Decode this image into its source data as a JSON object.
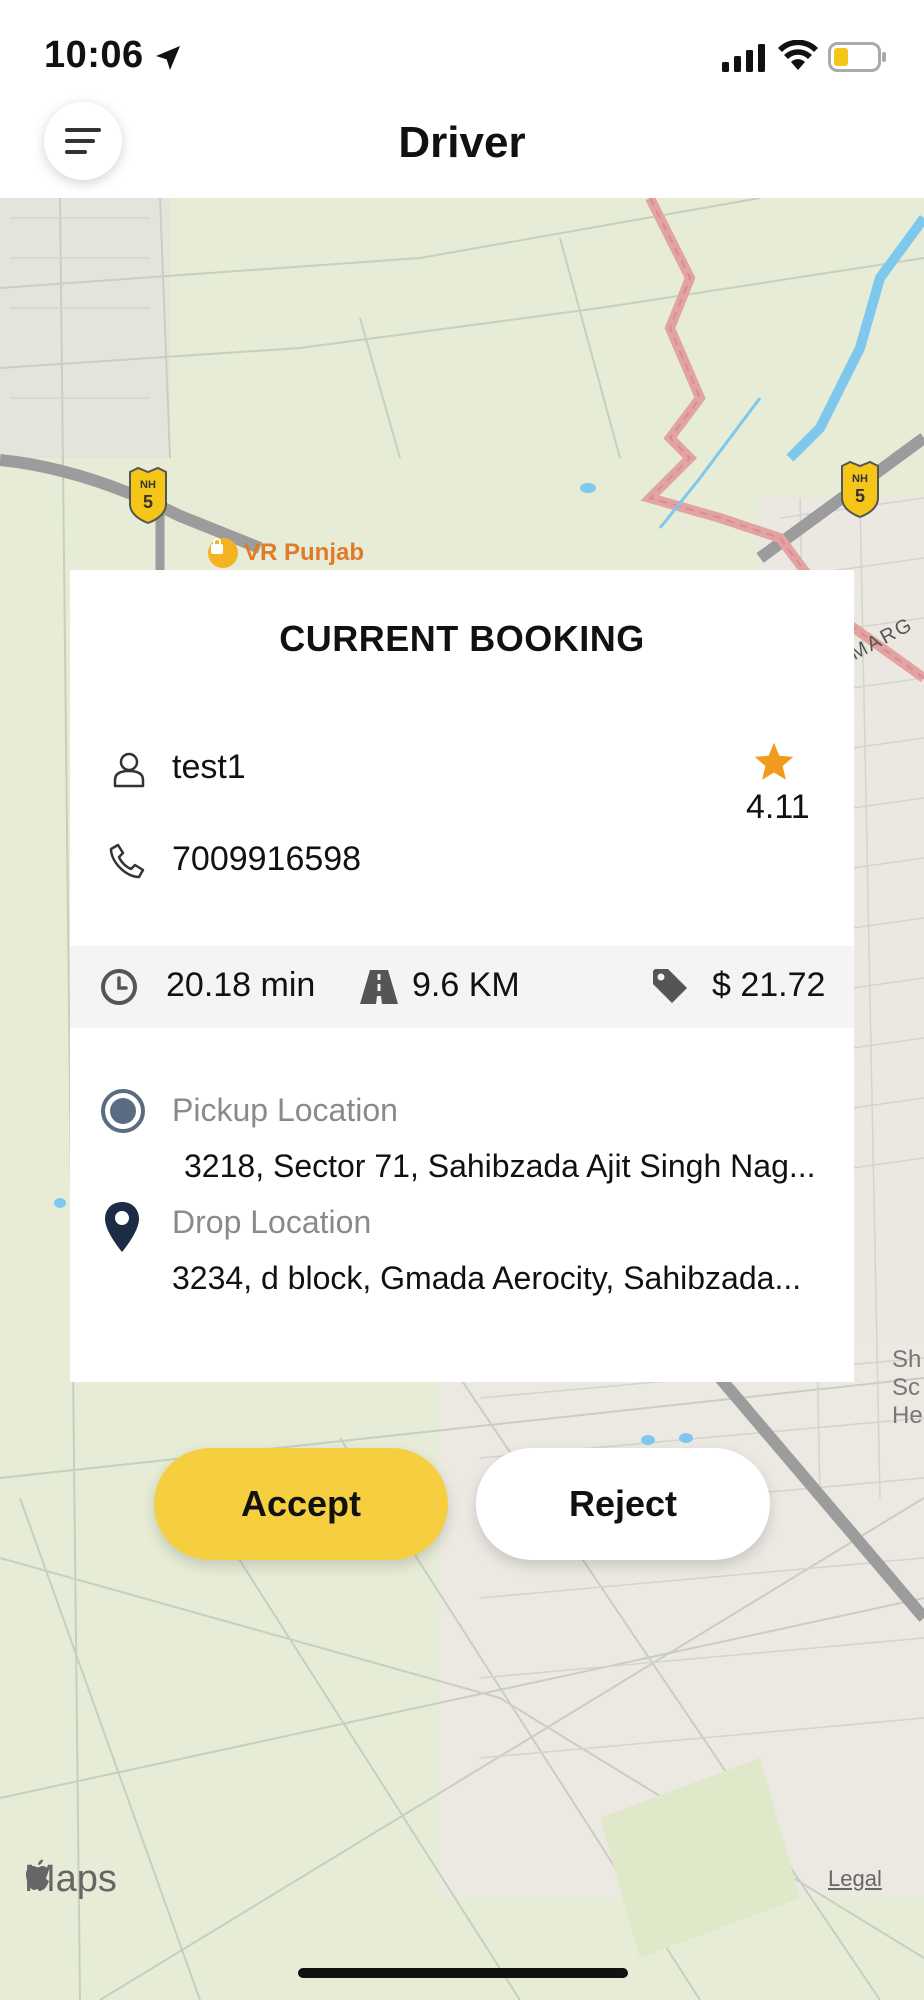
{
  "status_bar": {
    "time": "10:06",
    "icons": [
      "location-arrow-icon",
      "signal-icon",
      "wifi-icon",
      "battery-icon"
    ],
    "battery_color": "#f5c518"
  },
  "nav": {
    "title": "Driver",
    "menu_icon": "hamburger-menu-icon"
  },
  "map": {
    "poi_label": "VR Punjab",
    "highway_badges": [
      {
        "top": "NH",
        "bottom": "5"
      },
      {
        "top": "NH",
        "bottom": "5"
      }
    ],
    "road_label": "MARG",
    "edge_label_lines": [
      "Sh",
      "Sc",
      "He"
    ],
    "attribution": "Maps",
    "legal_link": "Legal"
  },
  "booking": {
    "title": "CURRENT BOOKING",
    "rider_name": "test1",
    "rider_phone": "7009916598",
    "rating": "4.11",
    "duration": "20.18 min",
    "distance": "9.6 KM",
    "fare": "$ 21.72",
    "pickup_label": "Pickup Location",
    "pickup_address": "3218, Sector 71, Sahibzada Ajit Singh Nag...",
    "drop_label": "Drop Location",
    "drop_address": "3234, d block, Gmada Aerocity, Sahibzada..."
  },
  "actions": {
    "accept_label": "Accept",
    "reject_label": "Reject"
  },
  "colors": {
    "accent": "#f6cf41",
    "star": "#f29a1f",
    "pickup_ring": "#5b6b82",
    "drop_pin": "#1e2b45"
  }
}
